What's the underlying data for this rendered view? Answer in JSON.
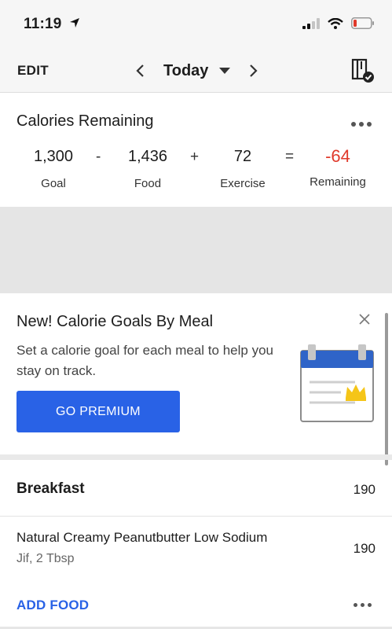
{
  "status_bar": {
    "time": "11:19",
    "icons": [
      "location-arrow-icon",
      "signal-icon",
      "wifi-icon",
      "battery-icon"
    ]
  },
  "nav": {
    "edit_label": "EDIT",
    "date_label": "Today",
    "icons": [
      "chevron-left-icon",
      "caret-down-icon",
      "chevron-right-icon",
      "diary-complete-icon"
    ]
  },
  "calories": {
    "title": "Calories Remaining",
    "goal": {
      "value": "1,300",
      "label": "Goal"
    },
    "op_minus": "-",
    "food": {
      "value": "1,436",
      "label": "Food"
    },
    "op_plus": "+",
    "exercise": {
      "value": "72",
      "label": "Exercise"
    },
    "op_equals": "=",
    "remaining": {
      "value": "-64",
      "label": "Remaining"
    }
  },
  "promo": {
    "title": "New! Calorie Goals By Meal",
    "text": "Set a calorie goal for each meal to help you stay on track.",
    "button_label": "GO PREMIUM"
  },
  "meal": {
    "name": "Breakfast",
    "calories": "190",
    "items": [
      {
        "name": "Natural Creamy Peanutbutter Low Sodium",
        "detail": "Jif, 2 Tbsp",
        "calories": "190"
      }
    ],
    "add_food_label": "ADD FOOD"
  },
  "colors": {
    "accent": "#2962e6",
    "negative": "#e0392b",
    "crown": "#f5c518"
  }
}
